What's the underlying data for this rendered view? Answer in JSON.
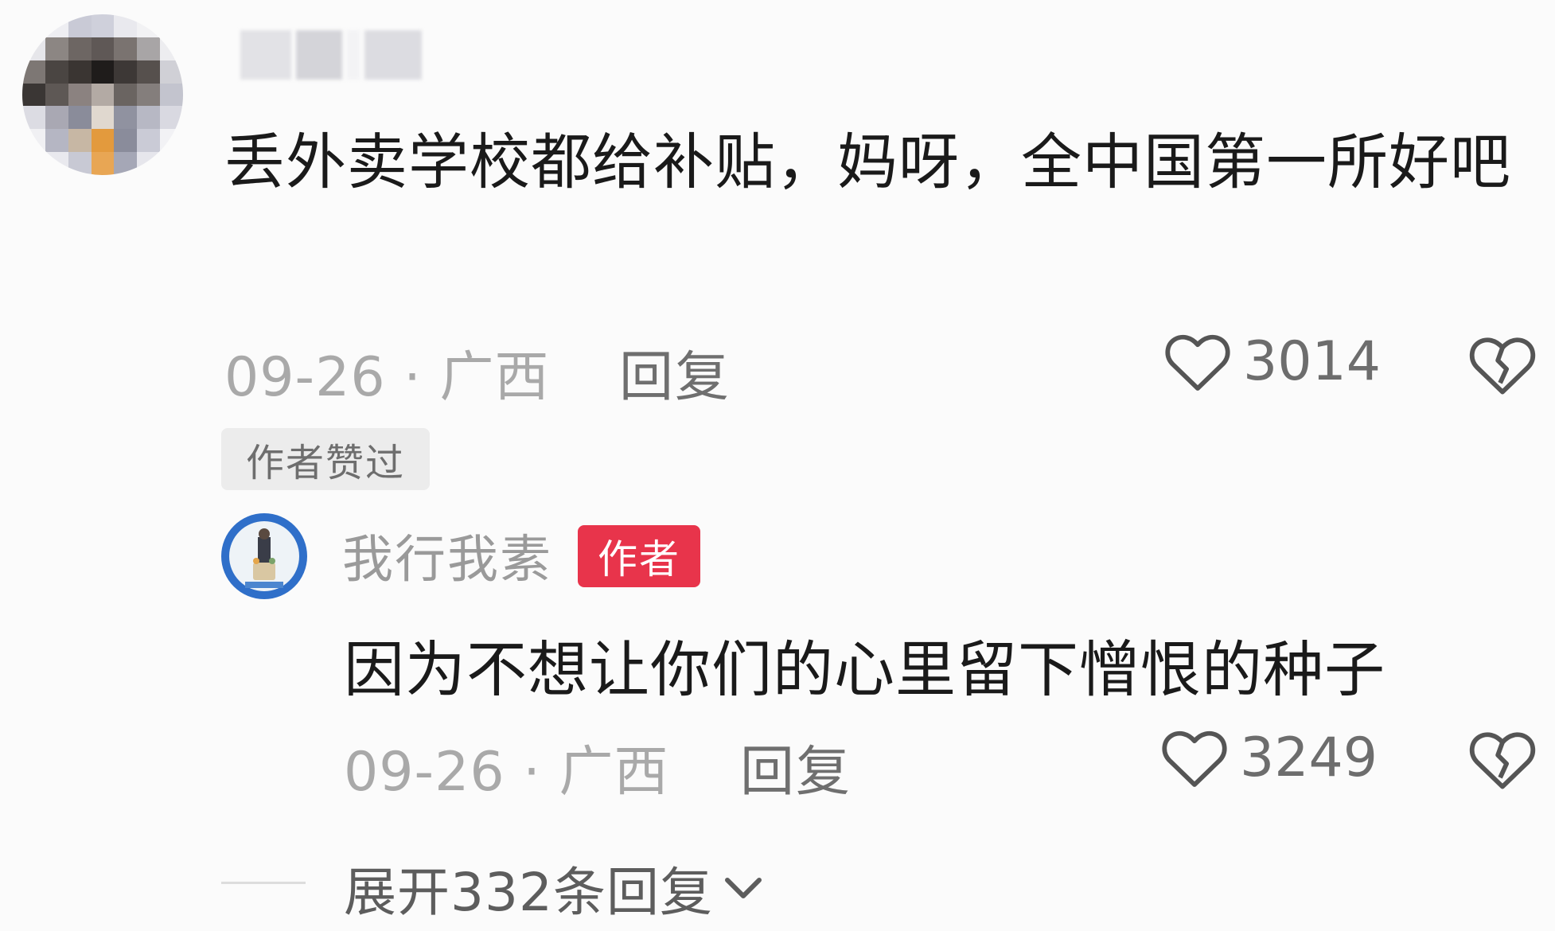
{
  "comment": {
    "text": "丢外卖学校都给补贴，妈呀，全中国第一所好吧",
    "date_location": "09-26 · 广西",
    "reply_label": "回复",
    "like_count": "3014",
    "liked_by_author_badge": "作者赞过"
  },
  "author_reply": {
    "username": "我行我素",
    "author_badge": "作者",
    "text": "因为不想让你们的心里留下憎恨的种子",
    "date_location": "09-26 · 广西",
    "reply_label": "回复",
    "like_count": "3249"
  },
  "expand_replies": {
    "label": "展开332条回复"
  },
  "colors": {
    "background": "#fbfbfb",
    "author_badge": "#e8344b",
    "meta_text": "#a9a9a9"
  },
  "icons": {
    "like": "heart-outline-icon",
    "dislike": "broken-heart-icon",
    "expand": "chevron-down-icon"
  }
}
